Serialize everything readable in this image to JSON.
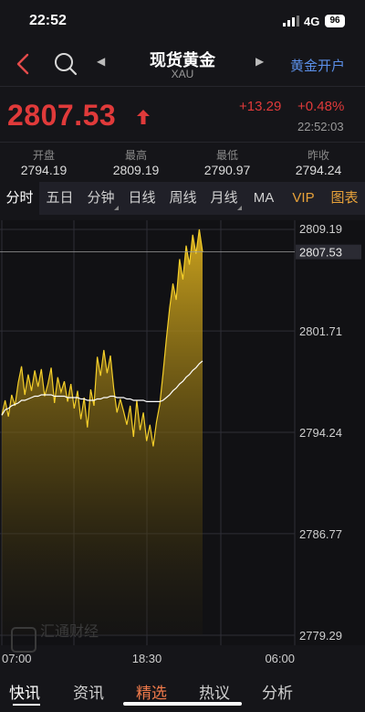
{
  "status_bar": {
    "time": "22:52",
    "network": "4G",
    "battery": "96"
  },
  "nav": {
    "title": "现货黄金",
    "subtitle": "XAU",
    "open_account": "黄金开户"
  },
  "quote": {
    "price": "2807.53",
    "change": "+13.29",
    "change_pct": "+0.48%",
    "time": "22:52:03",
    "up_color": "#e03a3a",
    "stats": [
      {
        "label": "开盘",
        "value": "2794.19"
      },
      {
        "label": "最高",
        "value": "2809.19"
      },
      {
        "label": "最低",
        "value": "2790.97"
      },
      {
        "label": "昨收",
        "value": "2794.24"
      }
    ]
  },
  "tabs": [
    {
      "label": "分时",
      "active": true
    },
    {
      "label": "五日"
    },
    {
      "label": "分钟",
      "dropdown": true
    },
    {
      "label": "日线"
    },
    {
      "label": "周线"
    },
    {
      "label": "月线",
      "dropdown": true
    },
    {
      "label": "MA"
    },
    {
      "label": "VIP",
      "highlight": true
    },
    {
      "label": "图表",
      "highlight": true
    }
  ],
  "chart_data": {
    "type": "area",
    "x_ticks": [
      "07:00",
      "18:30",
      "06:00"
    ],
    "y_ticks": [
      "2809.19",
      "2801.71",
      "2794.24",
      "2786.77",
      "2779.29"
    ],
    "ylim": [
      2779.29,
      2809.19
    ],
    "current_price_label": "2807.53",
    "fill_color": "#c9a21c",
    "avg_line_color": "#ffffff",
    "price": [
      2795.5,
      2796.6,
      2795.4,
      2797.0,
      2796.2,
      2797.9,
      2799.1,
      2797.0,
      2798.5,
      2797.3,
      2798.8,
      2797.6,
      2798.9,
      2796.9,
      2797.8,
      2799.0,
      2796.4,
      2798.3,
      2797.2,
      2798.0,
      2796.5,
      2797.8,
      2796.0,
      2797.3,
      2795.2,
      2796.8,
      2794.6,
      2797.4,
      2796.2,
      2799.8,
      2798.4,
      2800.3,
      2798.6,
      2799.9,
      2797.5,
      2795.7,
      2796.7,
      2795.8,
      2794.8,
      2796.2,
      2793.9,
      2796.6,
      2794.4,
      2795.7,
      2793.6,
      2794.8,
      2793.2,
      2795.0,
      2796.3,
      2798.6,
      2801.1,
      2803.4,
      2805.2,
      2804.0,
      2807.0,
      2805.5,
      2808.0,
      2806.6,
      2808.8,
      2807.4,
      2809.19,
      2807.53
    ],
    "avg": [
      2795.5,
      2795.9,
      2796.0,
      2796.2,
      2796.3,
      2796.4,
      2796.6,
      2796.6,
      2796.7,
      2796.8,
      2796.9,
      2796.9,
      2797.0,
      2797.0,
      2797.0,
      2797.0,
      2796.9,
      2796.9,
      2796.9,
      2796.9,
      2796.8,
      2796.8,
      2796.8,
      2796.8,
      2796.7,
      2796.7,
      2796.6,
      2796.6,
      2796.6,
      2796.7,
      2796.7,
      2796.8,
      2796.8,
      2796.9,
      2796.9,
      2796.8,
      2796.8,
      2796.8,
      2796.7,
      2796.7,
      2796.6,
      2796.6,
      2796.6,
      2796.6,
      2796.5,
      2796.5,
      2796.5,
      2796.5,
      2796.5,
      2796.6,
      2796.8,
      2797.0,
      2797.3,
      2797.5,
      2797.8,
      2798.0,
      2798.3,
      2798.5,
      2798.8,
      2799.0,
      2799.3,
      2799.5
    ]
  },
  "watermark": "汇通财经",
  "bottom_nav": [
    {
      "label": "快讯",
      "active": true
    },
    {
      "label": "资讯"
    },
    {
      "label": "精选",
      "hot": true
    },
    {
      "label": "热议"
    },
    {
      "label": "分析"
    }
  ]
}
